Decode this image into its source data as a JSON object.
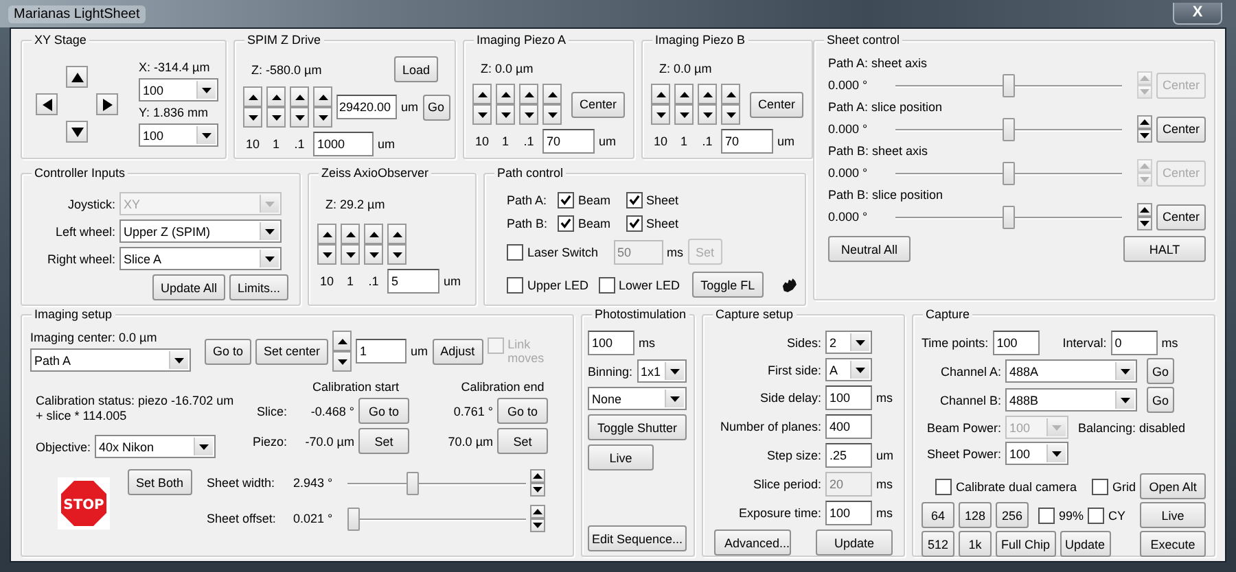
{
  "window": {
    "title": "Marianas LightSheet",
    "close": "X"
  },
  "groups": [
    {
      "title": "XY Stage",
      "rows": [
        {
          "items": [
            {
              "kind": "arrowpad"
            },
            {
              "kind": "stack",
              "rows": [
                {
                  "items": [
                    {
                      "kind": "label",
                      "text": "X: -314.4 µm"
                    }
                  ]
                },
                {
                  "items": [
                    {
                      "kind": "select",
                      "value": "100",
                      "disabled": false
                    }
                  ]
                },
                {
                  "items": [
                    {
                      "kind": "label",
                      "text": "Y: 1.836 mm"
                    }
                  ]
                },
                {
                  "items": [
                    {
                      "kind": "select",
                      "value": "100",
                      "disabled": false
                    }
                  ]
                }
              ]
            }
          ]
        }
      ]
    },
    {
      "title": "SPIM Z Drive",
      "rows": [
        {
          "items": [
            {
              "kind": "label",
              "text": "Z: -580.0 µm"
            },
            {
              "kind": "button",
              "label": "Load",
              "disabled": false
            }
          ]
        },
        {
          "items": [
            {
              "kind": "spin",
              "disabled": false
            },
            {
              "kind": "spin",
              "disabled": false
            },
            {
              "kind": "spin",
              "disabled": false
            },
            {
              "kind": "spin",
              "disabled": false
            },
            {
              "kind": "input",
              "value": "29420.00",
              "disabled": false
            },
            {
              "kind": "label",
              "text": "um"
            },
            {
              "kind": "button",
              "label": "Go",
              "disabled": false
            }
          ]
        },
        {
          "items": [
            {
              "kind": "tick",
              "text": "10"
            },
            {
              "kind": "tick",
              "text": "1"
            },
            {
              "kind": "tick",
              "text": ".1"
            },
            {
              "kind": "input",
              "value": "1000",
              "disabled": false
            },
            {
              "kind": "label",
              "text": "um"
            }
          ]
        }
      ]
    },
    {
      "title": "Imaging Piezo A",
      "rows": [
        {
          "items": [
            {
              "kind": "label",
              "text": "Z: 0.0 µm"
            }
          ]
        },
        {
          "items": [
            {
              "kind": "spin",
              "disabled": false
            },
            {
              "kind": "spin",
              "disabled": false
            },
            {
              "kind": "spin",
              "disabled": false
            },
            {
              "kind": "spin",
              "disabled": false
            },
            {
              "kind": "button",
              "label": "Center",
              "disabled": false
            }
          ]
        },
        {
          "items": [
            {
              "kind": "tick",
              "text": "10"
            },
            {
              "kind": "tick",
              "text": "1"
            },
            {
              "kind": "tick",
              "text": ".1"
            },
            {
              "kind": "input",
              "value": "70",
              "disabled": false
            },
            {
              "kind": "label",
              "text": "um"
            }
          ]
        }
      ]
    },
    {
      "title": "Imaging Piezo B",
      "rows": [
        {
          "items": [
            {
              "kind": "label",
              "text": "Z: 0.0 µm"
            }
          ]
        },
        {
          "items": [
            {
              "kind": "spin",
              "disabled": false
            },
            {
              "kind": "spin",
              "disabled": false
            },
            {
              "kind": "spin",
              "disabled": false
            },
            {
              "kind": "spin",
              "disabled": false
            },
            {
              "kind": "button",
              "label": "Center",
              "disabled": false
            }
          ]
        },
        {
          "items": [
            {
              "kind": "tick",
              "text": "10"
            },
            {
              "kind": "tick",
              "text": "1"
            },
            {
              "kind": "tick",
              "text": ".1"
            },
            {
              "kind": "input",
              "value": "70",
              "disabled": false
            },
            {
              "kind": "label",
              "text": "um"
            }
          ]
        }
      ]
    },
    {
      "title": "Sheet control",
      "rows": [
        {
          "items": [
            {
              "kind": "label",
              "text": "Path A: sheet axis"
            }
          ]
        },
        {
          "items": [
            {
              "kind": "label",
              "text": "0.000 °"
            },
            {
              "kind": "slider",
              "level": 0.5
            },
            {
              "kind": "spin",
              "disabled": true
            },
            {
              "kind": "button",
              "label": "Center",
              "disabled": true
            }
          ]
        },
        {
          "items": [
            {
              "kind": "label",
              "text": "Path A: slice position"
            }
          ]
        },
        {
          "items": [
            {
              "kind": "label",
              "text": "0.000 °"
            },
            {
              "kind": "slider",
              "level": 0.5
            },
            {
              "kind": "spin",
              "disabled": false
            },
            {
              "kind": "button",
              "label": "Center",
              "disabled": false
            }
          ]
        },
        {
          "items": [
            {
              "kind": "label",
              "text": "Path B: sheet axis"
            }
          ]
        },
        {
          "items": [
            {
              "kind": "label",
              "text": "0.000 °"
            },
            {
              "kind": "slider",
              "level": 0.5
            },
            {
              "kind": "spin",
              "disabled": true
            },
            {
              "kind": "button",
              "label": "Center",
              "disabled": true
            }
          ]
        },
        {
          "items": [
            {
              "kind": "label",
              "text": "Path B: slice position"
            }
          ]
        },
        {
          "items": [
            {
              "kind": "label",
              "text": "0.000 °"
            },
            {
              "kind": "slider",
              "level": 0.5
            },
            {
              "kind": "spin",
              "disabled": false
            },
            {
              "kind": "button",
              "label": "Center",
              "disabled": false
            }
          ]
        },
        {
          "items": [
            {
              "kind": "button",
              "label": "Neutral All",
              "disabled": false
            },
            {
              "kind": "button",
              "label": "HALT",
              "disabled": false
            }
          ]
        }
      ]
    },
    {
      "title": "Controller Inputs",
      "rows": [
        {
          "items": [
            {
              "kind": "label",
              "text": "Joystick:"
            },
            {
              "kind": "select",
              "value": "XY",
              "disabled": true
            }
          ]
        },
        {
          "items": [
            {
              "kind": "label",
              "text": "Left wheel:"
            },
            {
              "kind": "select",
              "value": "Upper Z (SPIM)",
              "disabled": false
            }
          ]
        },
        {
          "items": [
            {
              "kind": "label",
              "text": "Right wheel:"
            },
            {
              "kind": "select",
              "value": "Slice A",
              "disabled": false
            }
          ]
        },
        {
          "items": [
            {
              "kind": "button",
              "label": "Update All",
              "disabled": false
            },
            {
              "kind": "button",
              "label": "Limits...",
              "disabled": false
            }
          ]
        }
      ]
    },
    {
      "title": "Zeiss AxioObserver",
      "rows": [
        {
          "items": [
            {
              "kind": "label",
              "text": "Z: 29.2 µm"
            }
          ]
        },
        {
          "items": [
            {
              "kind": "spin",
              "disabled": false
            },
            {
              "kind": "spin",
              "disabled": false
            },
            {
              "kind": "spin",
              "disabled": false
            },
            {
              "kind": "spin",
              "disabled": false
            }
          ]
        },
        {
          "items": [
            {
              "kind": "tick",
              "text": "10"
            },
            {
              "kind": "tick",
              "text": "1"
            },
            {
              "kind": "tick",
              "text": ".1"
            },
            {
              "kind": "input",
              "value": "5",
              "disabled": false
            },
            {
              "kind": "label",
              "text": "um"
            }
          ]
        }
      ]
    },
    {
      "title": "Path control",
      "rows": [
        {
          "items": [
            {
              "kind": "label",
              "text": "Path A:"
            },
            {
              "kind": "check",
              "label": "Beam",
              "checked": true,
              "disabled": false
            },
            {
              "kind": "check",
              "label": "Sheet",
              "checked": true,
              "disabled": false
            }
          ]
        },
        {
          "items": [
            {
              "kind": "label",
              "text": "Path B:"
            },
            {
              "kind": "check",
              "label": "Beam",
              "checked": true,
              "disabled": false
            },
            {
              "kind": "check",
              "label": "Sheet",
              "checked": true,
              "disabled": false
            }
          ]
        },
        {
          "items": [
            {
              "kind": "check",
              "label": "Laser Switch",
              "checked": false,
              "disabled": false
            },
            {
              "kind": "input",
              "value": "50",
              "disabled": true
            },
            {
              "kind": "label",
              "text": "ms"
            },
            {
              "kind": "button",
              "label": "Set",
              "disabled": true
            }
          ]
        },
        {
          "items": [
            {
              "kind": "check",
              "label": "Upper LED",
              "checked": false,
              "disabled": false
            },
            {
              "kind": "check",
              "label": "Lower LED",
              "checked": false,
              "disabled": false
            },
            {
              "kind": "button",
              "label": "Toggle FL",
              "disabled": false
            },
            {
              "kind": "icon"
            }
          ]
        }
      ]
    },
    {
      "title": "Imaging setup",
      "rows": [
        {
          "items": [
            {
              "kind": "stack",
              "rows": [
                {
                  "items": [
                    {
                      "kind": "label",
                      "text": "Imaging center:  0.0 µm"
                    }
                  ]
                },
                {
                  "items": [
                    {
                      "kind": "select",
                      "value": "Path A",
                      "disabled": false
                    }
                  ]
                }
              ]
            },
            {
              "kind": "button",
              "label": "Go to",
              "disabled": false
            },
            {
              "kind": "button",
              "label": "Set center",
              "disabled": false
            },
            {
              "kind": "spin",
              "disabled": false
            },
            {
              "kind": "input",
              "value": "1",
              "disabled": false
            },
            {
              "kind": "label",
              "text": "um"
            },
            {
              "kind": "button",
              "label": "Adjust",
              "disabled": false
            },
            {
              "kind": "check",
              "label": "Link moves",
              "checked": false,
              "disabled": true
            }
          ]
        },
        {
          "items": [
            {
              "kind": "stack",
              "rows": [
                {
                  "items": [
                    {
                      "kind": "para",
                      "text": "Calibration status: piezo -16.702 um + slice * 114.005"
                    }
                  ]
                },
                {
                  "items": [
                    {
                      "kind": "label",
                      "text": "Objective:"
                    },
                    {
                      "kind": "select",
                      "value": "40x Nikon",
                      "disabled": false
                    }
                  ]
                }
              ]
            },
            {
              "kind": "stack",
              "rows": [
                {
                  "items": [
                    {
                      "kind": "label",
                      "text": "Calibration start"
                    },
                    {
                      "kind": "label",
                      "text": "Calibration end"
                    }
                  ]
                },
                {
                  "items": [
                    {
                      "kind": "label",
                      "text": "Slice:"
                    },
                    {
                      "kind": "label",
                      "text": "-0.468 °"
                    },
                    {
                      "kind": "button",
                      "label": "Go to",
                      "disabled": false
                    },
                    {
                      "kind": "label",
                      "text": "0.761 °"
                    },
                    {
                      "kind": "button",
                      "label": "Go to",
                      "disabled": false
                    }
                  ]
                },
                {
                  "items": [
                    {
                      "kind": "label",
                      "text": "Piezo:"
                    },
                    {
                      "kind": "label",
                      "text": "-70.0 µm"
                    },
                    {
                      "kind": "button",
                      "label": "Set",
                      "disabled": false
                    },
                    {
                      "kind": "label",
                      "text": "70.0 µm"
                    },
                    {
                      "kind": "button",
                      "label": "Set",
                      "disabled": false
                    }
                  ]
                }
              ]
            }
          ]
        },
        {
          "items": [
            {
              "kind": "stop",
              "text": "STOP"
            },
            {
              "kind": "button",
              "label": "Set Both",
              "disabled": false
            },
            {
              "kind": "stack",
              "rows": [
                {
                  "items": [
                    {
                      "kind": "label",
                      "text": "Sheet width:"
                    },
                    {
                      "kind": "label",
                      "text": "2.943 °"
                    },
                    {
                      "kind": "slider",
                      "level": 0.36
                    },
                    {
                      "kind": "spin",
                      "disabled": false
                    }
                  ]
                },
                {
                  "items": [
                    {
                      "kind": "label",
                      "text": "Sheet offset:"
                    },
                    {
                      "kind": "label",
                      "text": "0.021 °"
                    },
                    {
                      "kind": "slider",
                      "level": 0.0
                    },
                    {
                      "kind": "spin",
                      "disabled": false
                    }
                  ]
                }
              ]
            }
          ]
        }
      ]
    },
    {
      "title": "Photostimulation",
      "rows": [
        {
          "items": [
            {
              "kind": "input",
              "value": "100",
              "disabled": false
            },
            {
              "kind": "label",
              "text": "ms"
            }
          ]
        },
        {
          "items": [
            {
              "kind": "label",
              "text": "Binning:"
            },
            {
              "kind": "select",
              "value": "1x1",
              "disabled": false
            }
          ]
        },
        {
          "items": [
            {
              "kind": "select",
              "value": "None",
              "disabled": false
            }
          ]
        },
        {
          "items": [
            {
              "kind": "button",
              "label": "Toggle Shutter",
              "disabled": false
            }
          ]
        },
        {
          "items": [
            {
              "kind": "button",
              "label": "Live",
              "disabled": false
            }
          ]
        },
        {
          "items": [
            {
              "kind": "button",
              "label": "Edit Sequence...",
              "disabled": false
            }
          ]
        }
      ]
    },
    {
      "title": "Capture setup",
      "rows": [
        {
          "items": [
            {
              "kind": "label",
              "text": "Sides:"
            },
            {
              "kind": "select",
              "value": "2",
              "disabled": false
            }
          ]
        },
        {
          "items": [
            {
              "kind": "label",
              "text": "First side:"
            },
            {
              "kind": "select",
              "value": "A",
              "disabled": false
            }
          ]
        },
        {
          "items": [
            {
              "kind": "label",
              "text": "Side delay:"
            },
            {
              "kind": "input",
              "value": "100",
              "disabled": false
            },
            {
              "kind": "label",
              "text": "ms"
            }
          ]
        },
        {
          "items": [
            {
              "kind": "label",
              "text": "Number of planes:"
            },
            {
              "kind": "input",
              "value": "400",
              "disabled": false
            }
          ]
        },
        {
          "items": [
            {
              "kind": "label",
              "text": "Step size:"
            },
            {
              "kind": "input",
              "value": ".25",
              "disabled": false
            },
            {
              "kind": "label",
              "text": "um"
            }
          ]
        },
        {
          "items": [
            {
              "kind": "label",
              "text": "Slice period:"
            },
            {
              "kind": "input",
              "value": "20",
              "disabled": true
            },
            {
              "kind": "label",
              "text": "ms"
            }
          ]
        },
        {
          "items": [
            {
              "kind": "label",
              "text": "Exposure time:"
            },
            {
              "kind": "input",
              "value": "100",
              "disabled": false
            },
            {
              "kind": "label",
              "text": "ms"
            }
          ]
        },
        {
          "items": [
            {
              "kind": "button",
              "label": "Advanced...",
              "disabled": false
            },
            {
              "kind": "button",
              "label": "Update",
              "disabled": false
            }
          ]
        }
      ]
    },
    {
      "title": "Capture",
      "rows": [
        {
          "items": [
            {
              "kind": "label",
              "text": "Time points:"
            },
            {
              "kind": "input",
              "value": "100",
              "disabled": false
            },
            {
              "kind": "label",
              "text": "Interval:"
            },
            {
              "kind": "input",
              "value": "0",
              "disabled": false
            },
            {
              "kind": "label",
              "text": "ms"
            }
          ]
        },
        {
          "items": [
            {
              "kind": "label",
              "text": "Channel A:"
            },
            {
              "kind": "select",
              "value": "488A",
              "disabled": false
            },
            {
              "kind": "button",
              "label": "Go",
              "disabled": false
            }
          ]
        },
        {
          "items": [
            {
              "kind": "label",
              "text": "Channel B:"
            },
            {
              "kind": "select",
              "value": "488B",
              "disabled": false
            },
            {
              "kind": "button",
              "label": "Go",
              "disabled": false
            }
          ]
        },
        {
          "items": [
            {
              "kind": "label",
              "text": "Beam Power:"
            },
            {
              "kind": "select",
              "value": "100",
              "disabled": true
            },
            {
              "kind": "label",
              "text": "Balancing: disabled"
            }
          ]
        },
        {
          "items": [
            {
              "kind": "label",
              "text": "Sheet Power:"
            },
            {
              "kind": "select",
              "value": "100",
              "disabled": false
            }
          ]
        },
        {
          "items": [
            {
              "kind": "check",
              "label": "Calibrate dual camera",
              "checked": false,
              "disabled": false
            },
            {
              "kind": "check",
              "label": "Grid",
              "checked": false,
              "disabled": false
            },
            {
              "kind": "button",
              "label": "Open Alt",
              "disabled": false
            }
          ]
        },
        {
          "items": [
            {
              "kind": "button",
              "label": "64",
              "disabled": false
            },
            {
              "kind": "button",
              "label": "128",
              "disabled": false
            },
            {
              "kind": "button",
              "label": "256",
              "disabled": false
            },
            {
              "kind": "check",
              "label": "99%",
              "checked": false,
              "disabled": false
            },
            {
              "kind": "check",
              "label": "CY",
              "checked": false,
              "disabled": false
            },
            {
              "kind": "button",
              "label": "Live",
              "disabled": false
            }
          ]
        },
        {
          "items": [
            {
              "kind": "button",
              "label": "512",
              "disabled": false
            },
            {
              "kind": "button",
              "label": "1k",
              "disabled": false
            },
            {
              "kind": "button",
              "label": "Full Chip",
              "disabled": false
            },
            {
              "kind": "button",
              "label": "Update",
              "disabled": false
            },
            {
              "kind": "button",
              "label": "Execute",
              "disabled": false
            }
          ]
        }
      ]
    }
  ]
}
